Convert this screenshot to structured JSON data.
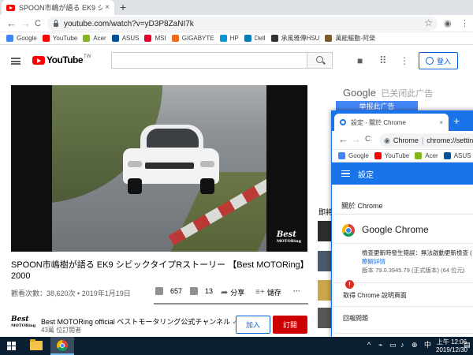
{
  "browser": {
    "tab": {
      "title": "SPOON市嶋が語る EK9 シ",
      "close": "×"
    },
    "new_tab": "+",
    "window_controls": {
      "minimize": "—",
      "maximize": "☐",
      "close": "✕"
    },
    "nav": {
      "back": "←",
      "forward": "→",
      "reload": "C"
    },
    "url": "youtube.com/watch?v=yD3P8ZaNI7k",
    "bookmarks": [
      {
        "label": "Google",
        "icon": "google-icon",
        "color": "#4285f4"
      },
      {
        "label": "YouTube",
        "icon": "youtube-icon",
        "color": "#ff0000"
      },
      {
        "label": "Acer",
        "icon": "acer-icon",
        "color": "#83b81a"
      },
      {
        "label": "ASUS",
        "icon": "asus-icon",
        "color": "#00539b"
      },
      {
        "label": "MSI",
        "icon": "msi-icon",
        "color": "#e4002b"
      },
      {
        "label": "GIGABYTE",
        "icon": "gigabyte-icon",
        "color": "#f26a20"
      },
      {
        "label": "HP",
        "icon": "hp-icon",
        "color": "#0096d6"
      },
      {
        "label": "Dell",
        "icon": "dell-icon",
        "color": "#007db8"
      },
      {
        "label": "承風雅傳HSU",
        "icon": "camera-icon",
        "color": "#333333"
      },
      {
        "label": "萬能驅動-阿榮",
        "icon": "driver-icon",
        "color": "#7a5c2e"
      }
    ]
  },
  "youtube": {
    "logo_text": "YouTube",
    "logo_region": "TW",
    "signin_label": "登入",
    "video": {
      "watermark_line1": "Best",
      "watermark_line2": "MOTORing"
    },
    "title_line1": "SPOON市嶋樹が語る EK9 シビックタイプRストーリー 【Best MOTORing】",
    "title_line2": "2000",
    "views": "觀看次數：38,620次",
    "date": "2019年1月19日",
    "likes": "657",
    "dislikes": "13",
    "share_label": "分享",
    "save_label": "儲存",
    "more_label": "···",
    "channel_logo_line1": "Best",
    "channel_logo_line2": "MOTORing",
    "channel_name": "Best MOTORing official ベストモータリング公式チャンネル",
    "subscribers": "43萬 位訂閱者",
    "join_label": "加入",
    "subscribe_label": "訂閱",
    "ad_google": "Google",
    "ad_closed": "已关闭此广告",
    "ad_why": "举报此广告",
    "side_label": "即將"
  },
  "settings_window": {
    "tab_title": "設定 - 關於 Chrome",
    "close": "×",
    "new_tab": "+",
    "omnibox_host": "Chrome",
    "omnibox_url": "chrome://settin",
    "bookmarks": [
      {
        "label": "Google",
        "icon": "google-icon",
        "color": "#4285f4"
      },
      {
        "label": "YouTube",
        "icon": "youtube-icon",
        "color": "#ff0000"
      },
      {
        "label": "Acer",
        "icon": "acer-icon",
        "color": "#83b81a"
      },
      {
        "label": "ASUS",
        "icon": "asus-icon",
        "color": "#00539b"
      }
    ],
    "header_title": "設定",
    "section_title": "關於 Chrome",
    "product_name": "Google Chrome",
    "update_error": "檢查更新時發生錯誤：無法啟動更新檢查 (",
    "learn_more": "瞭解詳情",
    "version": "版本 79.0.3945.79 (正式版本) (64 位元)",
    "help_link": "取得 Chrome 說明頁面",
    "report_link": "回報問題"
  },
  "taskbar": {
    "time": "上午 12:06",
    "date": "2019/12/30",
    "tray_up": "^",
    "tray_symbols": [
      "⌁",
      "▭",
      "♪",
      "⊕"
    ],
    "ime": "中",
    "notification": "▤"
  }
}
